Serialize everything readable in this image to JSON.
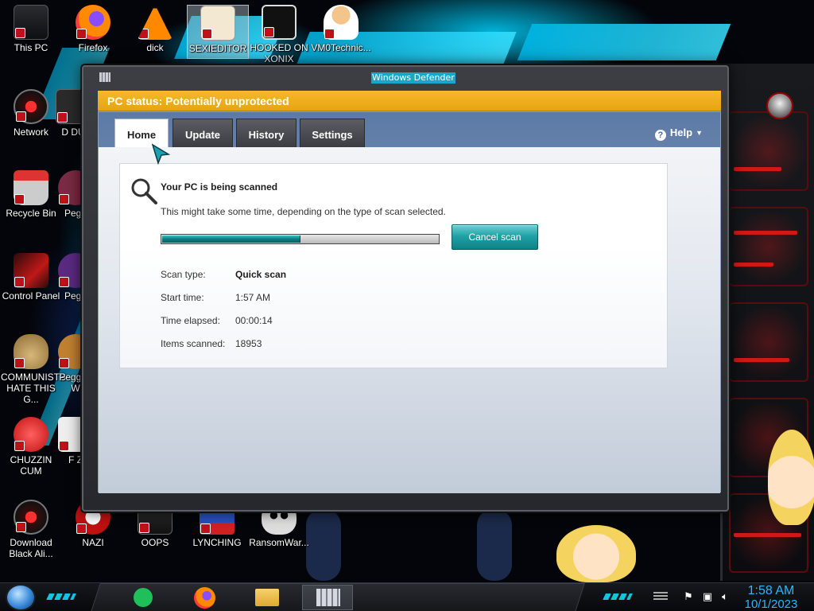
{
  "desktop": {
    "icons": [
      {
        "label": "This PC",
        "icon": "this-pc-icon"
      },
      {
        "label": "Firefox",
        "icon": "firefox-icon"
      },
      {
        "label": "dick",
        "icon": "vlc-cone-icon"
      },
      {
        "label": "SEXIEDITOR",
        "icon": "hxd-editor-icon"
      },
      {
        "label": "HOOKED ON XONIX",
        "icon": "xonix-game-icon"
      },
      {
        "label": "VM0Technic...",
        "icon": "doctor-icon"
      },
      {
        "label": "Network",
        "icon": "network-icon"
      },
      {
        "label": "D DU",
        "icon": "partial-icon"
      },
      {
        "label": "Recycle Bin",
        "icon": "recycle-bin-icon"
      },
      {
        "label": "Pegg",
        "icon": "partial-icon"
      },
      {
        "label": "Control Panel",
        "icon": "control-panel-icon"
      },
      {
        "label": "Pegg",
        "icon": "partial-icon"
      },
      {
        "label": "COMMUNISTS HATE THIS G...",
        "icon": "money-bag-icon"
      },
      {
        "label": "Pegg of W",
        "icon": "partial-icon"
      },
      {
        "label": "CHUZZIN CUM",
        "icon": "chuzzle-icon"
      },
      {
        "label": "F Z",
        "icon": "partial-icon"
      },
      {
        "label": "Download Black Ali...",
        "icon": "alienware-icon"
      },
      {
        "label": "NAZI",
        "icon": "nazi-app-icon"
      },
      {
        "label": "OOPS",
        "icon": "oops-app-icon"
      },
      {
        "label": "LYNCHING",
        "icon": "lynching-app-icon"
      },
      {
        "label": "RansomWar...",
        "icon": "skull-icon"
      }
    ]
  },
  "window": {
    "title": "Windows Defender",
    "status_text": "PC status: Potentially unprotected",
    "status_color": "#f0b020",
    "tabs": [
      {
        "label": "Home",
        "active": true
      },
      {
        "label": "Update",
        "active": false
      },
      {
        "label": "History",
        "active": false
      },
      {
        "label": "Settings",
        "active": false
      }
    ],
    "help_label": "Help",
    "scan": {
      "title": "Your PC is being scanned",
      "description": "This might take some time, depending on the type of scan selected.",
      "progress": 0.5,
      "cancel_label": "Cancel scan",
      "details": [
        {
          "key": "Scan type:",
          "value": "Quick scan",
          "bold": true
        },
        {
          "key": "Start time:",
          "value": "1:57 AM",
          "bold": false
        },
        {
          "key": "Time elapsed:",
          "value": "00:00:14",
          "bold": false
        },
        {
          "key": "Items scanned:",
          "value": "18953",
          "bold": false
        }
      ]
    }
  },
  "taskbar": {
    "pinned": [
      {
        "name": "sticky-notes-icon"
      },
      {
        "name": "firefox-icon"
      },
      {
        "name": "file-explorer-icon"
      },
      {
        "name": "windows-defender-icon",
        "active": true
      }
    ],
    "tray": [
      "flag-icon",
      "network-icon",
      "volume-icon"
    ],
    "time": "1:58 AM",
    "date": "10/1/2023",
    "clock_color": "#2ab8ff"
  }
}
